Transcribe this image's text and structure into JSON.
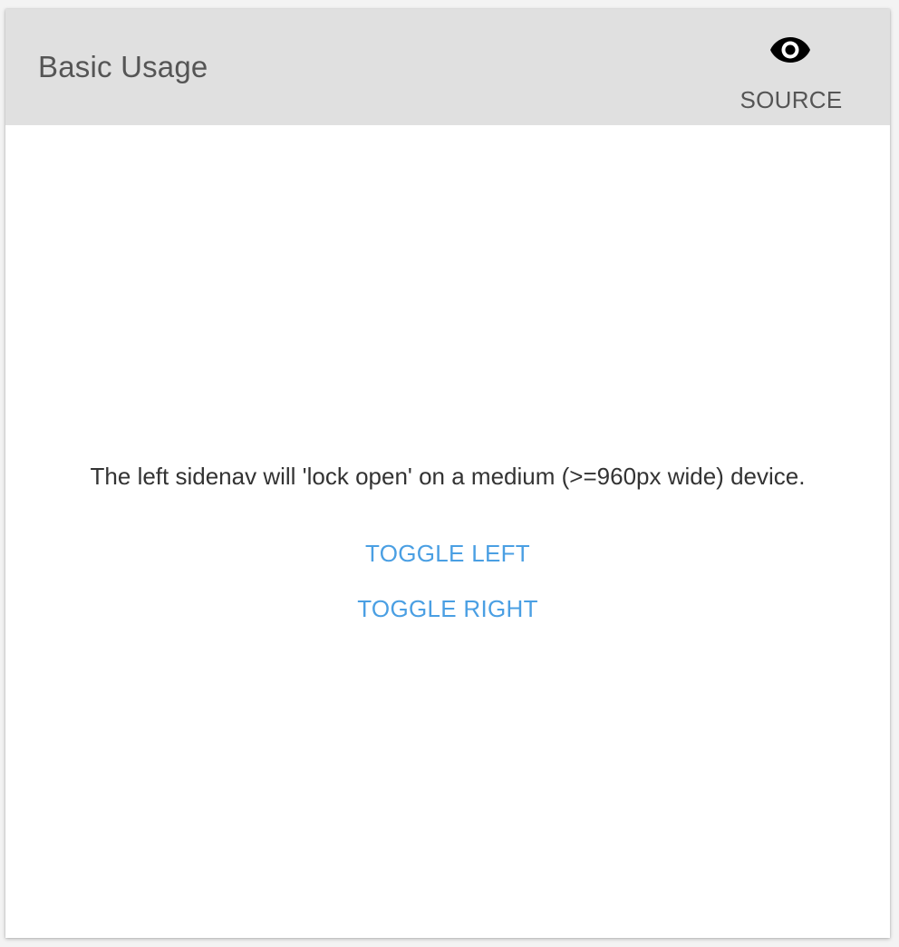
{
  "header": {
    "title": "Basic Usage",
    "source_button": {
      "icon": "eye-icon",
      "label": "SOURCE"
    }
  },
  "main": {
    "info_text": "The left sidenav will 'lock open' on a medium (>=960px wide) device.",
    "toggle_left_label": "TOGGLE LEFT",
    "toggle_right_label": "TOGGLE RIGHT"
  },
  "colors": {
    "toolbar_background": "#e0e0e0",
    "accent": "#4a9fe3",
    "title_text": "#555555",
    "body_text": "#333333"
  }
}
